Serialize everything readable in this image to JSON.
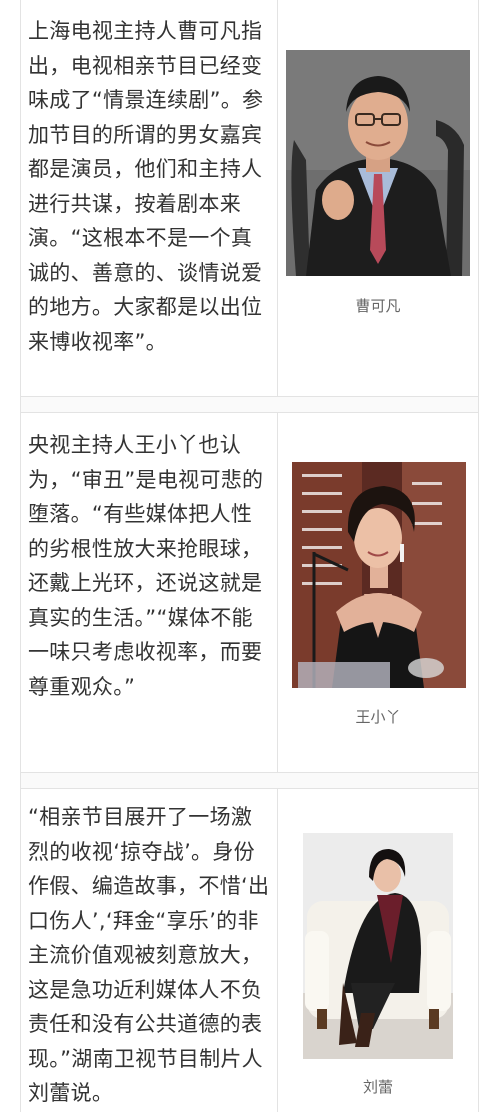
{
  "rows": [
    {
      "text": "上海电视主持人曹可凡指出，电视相亲节目已经变味成了“情景连续剧”。参加节目的所谓的男女嘉宾都是演员，他们和主持人进行共谋，按着剧本来演。“这根本不是一个真诚的、善意的、谈情说爱的地方。大家都是以出位来博收视率”。",
      "caption": "曹可凡"
    },
    {
      "text": "央视主持人王小丫也认为，“审丑”是电视可悲的堕落。“有些媒体把人性的劣根性放大来抢眼球，还戴上光环，还说这就是真实的生活。”“媒体不能一味只考虑收视率，而要尊重观众。”",
      "caption": "王小丫"
    },
    {
      "text": "“相亲节目展开了一场激烈的收视‘掠夺战’。身份作假、编造故事，不惜‘出口伤人’,‘拜金“享乐’的非主流价值观被刻意放大，这是急功近利媒体人不负责任和没有公共道德的表现。”湖南卫视节目制片人刘蕾说。",
      "caption": "刘蕾"
    }
  ]
}
